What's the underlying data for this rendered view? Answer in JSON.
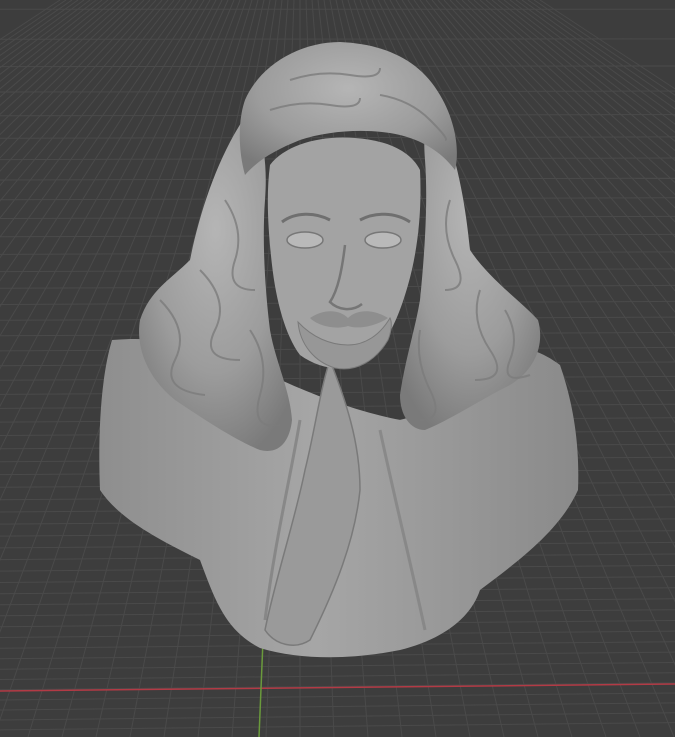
{
  "app": {
    "name": ""
  },
  "viewport": {
    "mode": "solid",
    "background_color": "#3d3d3d",
    "grid_color": "#4a4a4a",
    "x_axis_color": "#b33a45",
    "y_axis_color": "#6a9a3c",
    "object": {
      "kind": "bust-sculpture",
      "material_color": "#9a9a9a",
      "shadow_color": "#6e6e6e",
      "highlight_color": "#b9b9b9"
    }
  }
}
